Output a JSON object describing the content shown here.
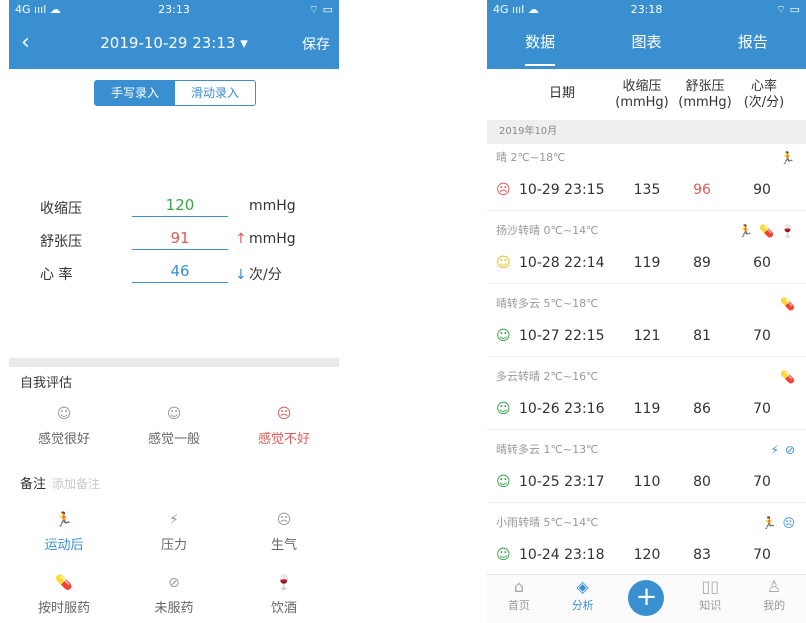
{
  "left": {
    "status": {
      "signal": "4G ıııl ☁",
      "time": "23:13",
      "battery": "⌔ ▭"
    },
    "title": {
      "back": "‹",
      "datetime": "2019-10-29 23:13 ▾",
      "save": "保存"
    },
    "segment": {
      "manual": "手写录入",
      "slide": "滑动录入"
    },
    "form": {
      "systolic": {
        "label": "收缩压",
        "value": "120",
        "unit": "mmHg",
        "color": "#3aa34a"
      },
      "diastolic": {
        "label": "舒张压",
        "value": "91",
        "unit": "mmHg",
        "arrow": "↑",
        "color": "#e05a55"
      },
      "heart": {
        "label": "心  率",
        "value": "46",
        "unit": "次/分",
        "arrow": "↓",
        "color": "#3a8fd0"
      }
    },
    "self_assessment": {
      "title": "自我评估",
      "items": [
        {
          "label": "感觉很好",
          "icon": "☺"
        },
        {
          "label": "感觉一般",
          "icon": "☺"
        },
        {
          "label": "感觉不好",
          "icon": "☹",
          "color": "#e05a55"
        }
      ]
    },
    "notes": {
      "title": "备注",
      "placeholder": "添加备注",
      "tags": [
        {
          "label": "运动后",
          "icon": "🏃",
          "color": "#3a8fd0"
        },
        {
          "label": "压力",
          "icon": "⚡"
        },
        {
          "label": "生气",
          "icon": "☹"
        },
        {
          "label": "按时服药",
          "icon": "💊"
        },
        {
          "label": "未服药",
          "icon": "⊘"
        },
        {
          "label": "饮酒",
          "icon": "🍷"
        }
      ]
    }
  },
  "right": {
    "status": {
      "signal": "4G ıııl ☁",
      "time": "23:18",
      "battery": "⌔ ▭"
    },
    "tabs": [
      "数据",
      "图表",
      "报告"
    ],
    "headers": {
      "date": "日期",
      "systolic": "收缩压",
      "systolic_unit": "(mmHg)",
      "diastolic": "舒张压",
      "diastolic_unit": "(mmHg)",
      "hr": "心率",
      "hr_unit": "(次/分)"
    },
    "month": "2019年10月",
    "records": [
      {
        "weather": "晴 2℃~18℃",
        "icons": "🏃",
        "face": "☹",
        "face_color": "#e05a55",
        "date": "10-29 23:15",
        "systolic": "135",
        "diastolic": "96",
        "diastolic_color": "#e05a55",
        "hr": "90"
      },
      {
        "weather": "扬沙转晴 0℃~14℃",
        "icons": "🏃💊🍷",
        "face": "☺",
        "face_color": "#e8c12a",
        "date": "10-28 22:14",
        "systolic": "119",
        "diastolic": "89",
        "diastolic_color": "#333",
        "hr": "60"
      },
      {
        "weather": "晴转多云 5℃~18℃",
        "icons": "💊",
        "face": "☺",
        "face_color": "#3aa34a",
        "date": "10-27 22:15",
        "systolic": "121",
        "diastolic": "81",
        "diastolic_color": "#333",
        "hr": "70"
      },
      {
        "weather": "多云转晴 2℃~16℃",
        "icons": "💊",
        "face": "☺",
        "face_color": "#3aa34a",
        "date": "10-26 23:16",
        "systolic": "119",
        "diastolic": "86",
        "diastolic_color": "#333",
        "hr": "70"
      },
      {
        "weather": "晴转多云 1℃~13℃",
        "icons": "⚡⊘",
        "face": "☺",
        "face_color": "#3aa34a",
        "date": "10-25 23:17",
        "systolic": "110",
        "diastolic": "80",
        "diastolic_color": "#333",
        "hr": "70"
      },
      {
        "weather": "小雨转晴 5℃~14℃",
        "icons": "🏃☹",
        "face": "☺",
        "face_color": "#3aa34a",
        "date": "10-24 23:18",
        "systolic": "120",
        "diastolic": "83",
        "diastolic_color": "#333",
        "hr": "70"
      }
    ],
    "nav": [
      {
        "label": "首页",
        "icon": "⌂"
      },
      {
        "label": "分析",
        "icon": "◈",
        "active": true
      },
      {
        "label": "",
        "icon": "+"
      },
      {
        "label": "知识",
        "icon": "▯▯"
      },
      {
        "label": "我的",
        "icon": "♙"
      }
    ]
  }
}
